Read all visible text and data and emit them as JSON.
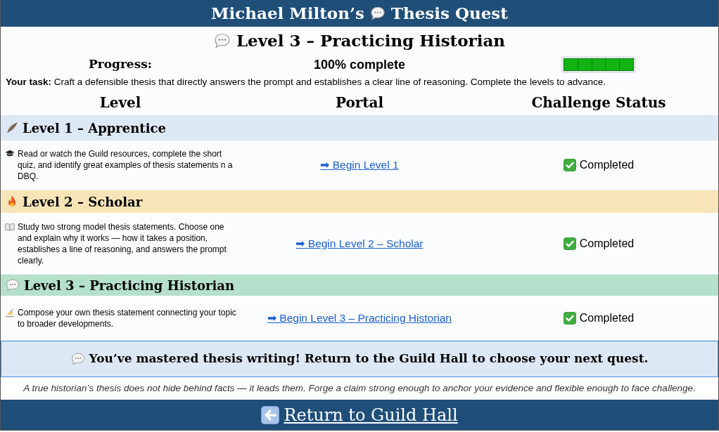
{
  "header": {
    "title_before": "Michael Milton’s",
    "title_after": "Thesis Quest"
  },
  "level_title": "Level 3 – Practicing Historian",
  "progress": {
    "label": "Progress:",
    "reading": "100% complete",
    "level": 1
  },
  "task": "**Your task:** Craft a defensible thesis that directly answers the prompt and establishes a clear line of reasoning. Complete the levels to advance.",
  "table": {
    "columns": [
      "Level",
      "Portal",
      "Challenge Status"
    ],
    "levels": [
      {
        "title": "Level 1 – Apprentice",
        "color": "#dde8f5",
        "description": "Read or watch the Guild resources, complete the short quiz, and identify great examples of thesis statements n a DBQ.",
        "link": "➡ Begin Level 1",
        "status": "Completed",
        "completed": true
      },
      {
        "title": "Level 2 – Scholar",
        "color": "#f7e5b7",
        "description": "Study two strong model thesis statements. Choose one and explain why it works — how it takes a position, establishes a line of reasoning, and answers the prompt clearly.",
        "link": "➡ Begin Level 2 – Scholar",
        "status": "Completed",
        "completed": true
      },
      {
        "title": "Level 3 – Practicing Historian",
        "color": "#b5e0cc",
        "description": "Compose your own thesis statement connecting your topic to broader developments.",
        "link": "➡ Begin Level 3 – Practicing Historian",
        "status": "Completed",
        "completed": true
      }
    ]
  },
  "banner": "You’ve mastered thesis writing! Return to the Guild Hall to choose your next quest.",
  "quote": "A true historian’s thesis does not hide behind facts — it leads them. Forge a claim strong enough to anchor your evidence and flexible enough to face challenge.",
  "footer": {
    "link": "Return to Guild Hall"
  }
}
